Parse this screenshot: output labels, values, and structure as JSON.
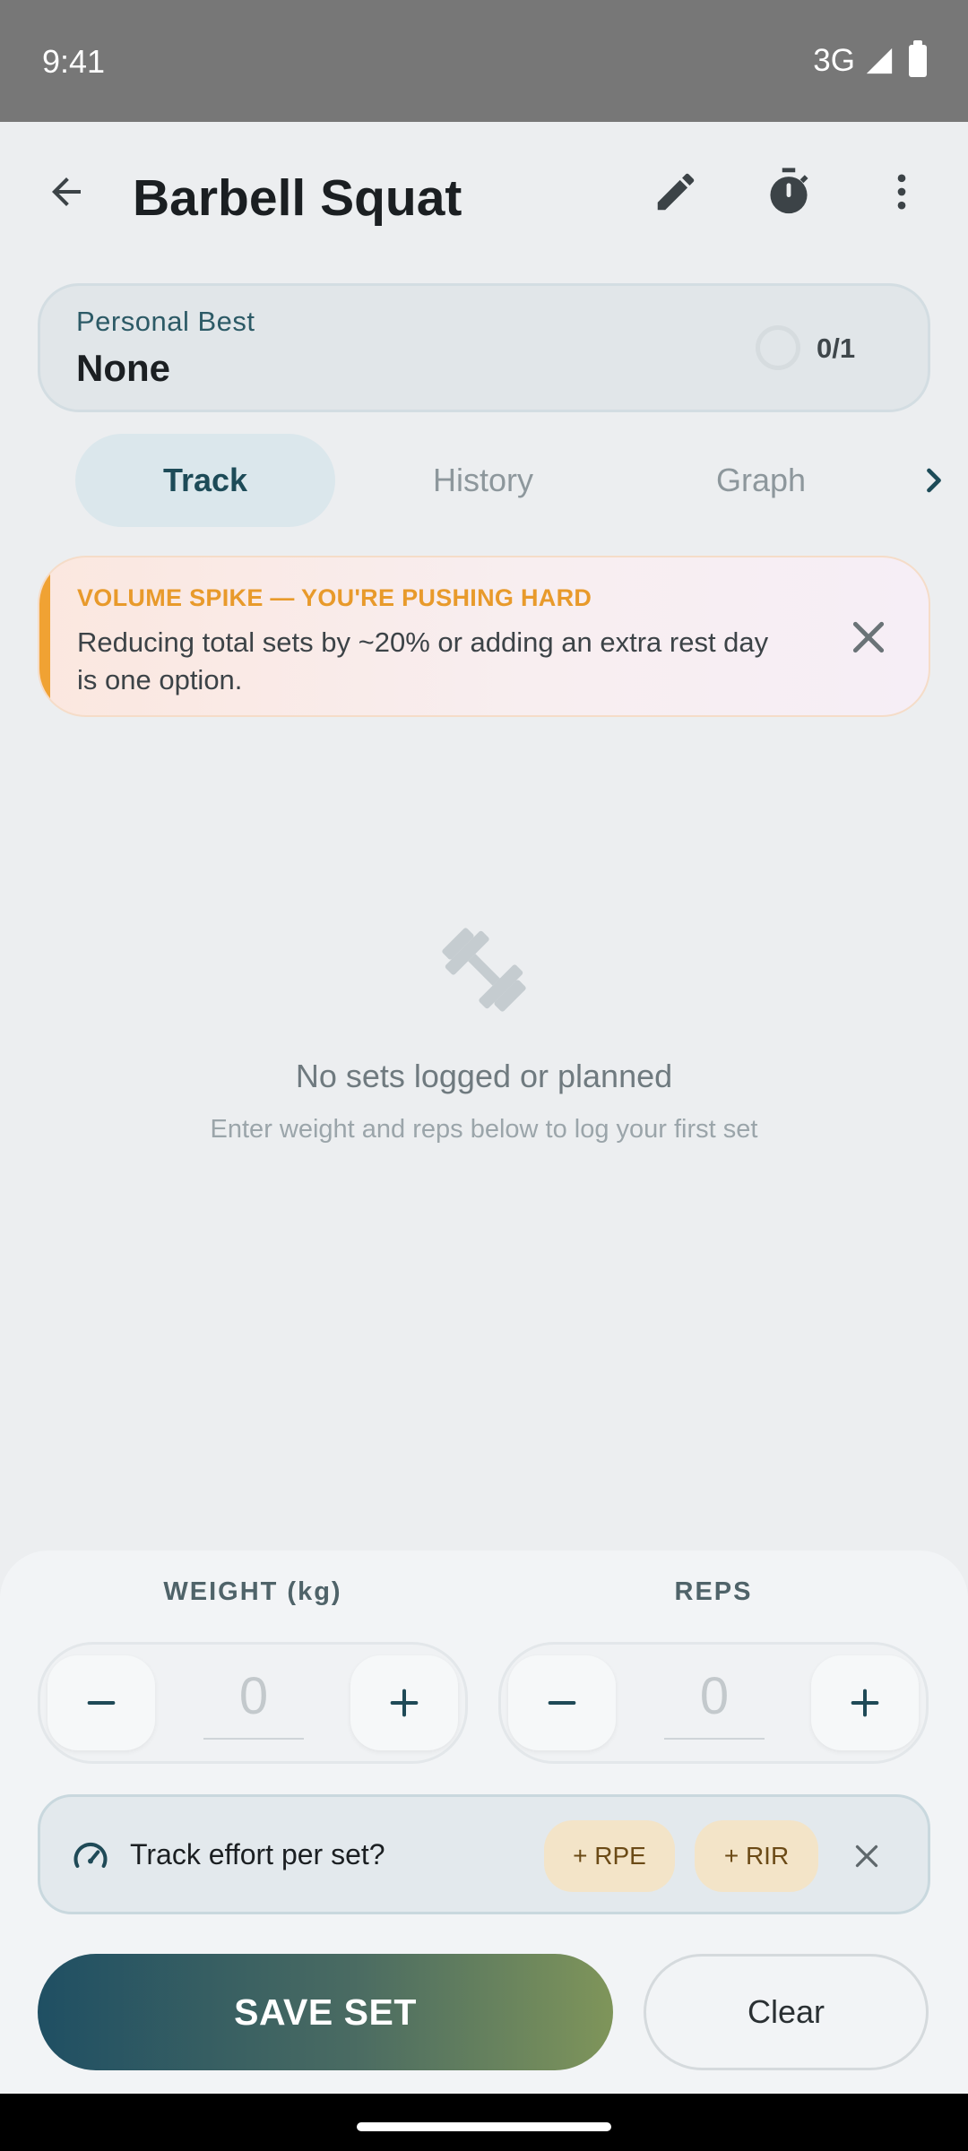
{
  "status": {
    "time": "9:41",
    "network": "3G"
  },
  "header": {
    "title": "Barbell Squat"
  },
  "icons": {
    "back": "arrow-back-icon",
    "edit": "pencil-icon",
    "timer": "stopwatch-icon",
    "more": "more-vert-icon"
  },
  "personal_best": {
    "label": "Personal Best",
    "value": "None",
    "count": "0/1"
  },
  "tabs": [
    {
      "label": "Track",
      "active": true
    },
    {
      "label": "History",
      "active": false
    },
    {
      "label": "Graph",
      "active": false
    }
  ],
  "alert": {
    "title": "VOLUME SPIKE — YOU'RE PUSHING HARD",
    "body": "Reducing total sets by ~20% or adding an extra rest day is one option."
  },
  "empty_state": {
    "title": "No sets logged or planned",
    "subtitle": "Enter weight and reps below to log your first set"
  },
  "inputs": {
    "weight": {
      "label": "WEIGHT (kg)",
      "value": "0"
    },
    "reps": {
      "label": "REPS",
      "value": "0"
    }
  },
  "effort": {
    "prompt": "Track effort per set?",
    "rpe_label": "+ RPE",
    "rir_label": "+ RIR"
  },
  "actions": {
    "save_label": "SAVE SET",
    "clear_label": "Clear"
  },
  "colors": {
    "accent": "#1d4b58",
    "warning": "#e89a2b",
    "save_start": "#1f4f63",
    "save_end": "#7f955a"
  }
}
